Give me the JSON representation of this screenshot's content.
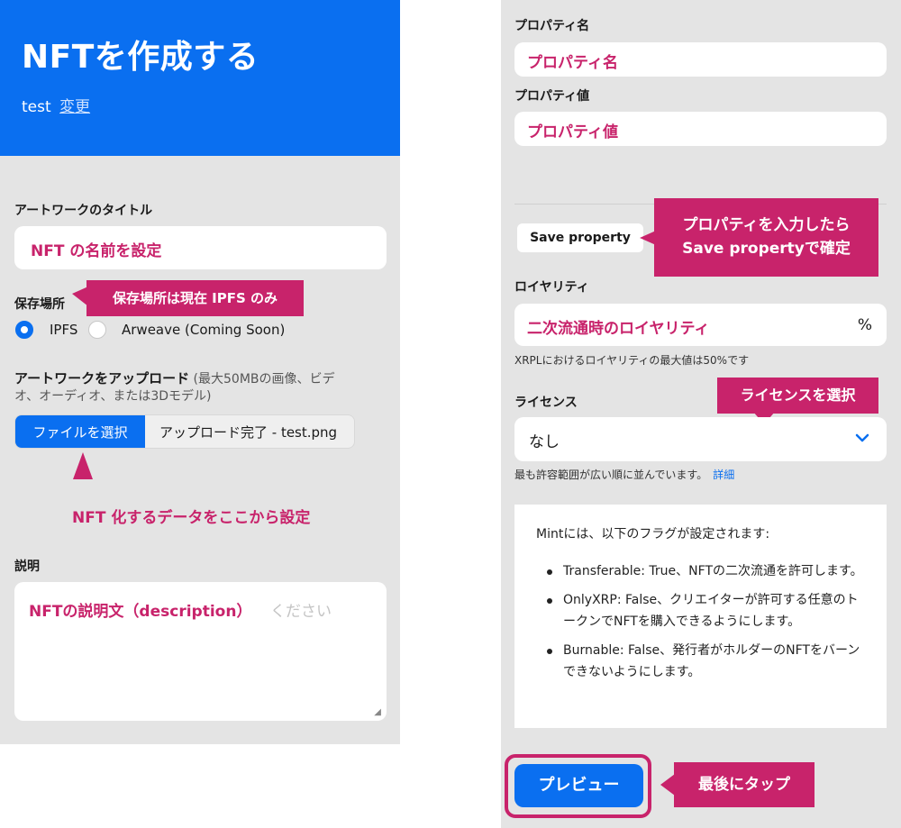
{
  "header": {
    "title": "NFTを作成する",
    "account": "test",
    "change_link": "変更"
  },
  "artwork_title": {
    "label": "アートワークのタイトル",
    "annotation": "NFT の名前を設定"
  },
  "storage": {
    "label": "保存場所",
    "callout": "保存場所は現在 IPFS のみ",
    "options": [
      {
        "label": "IPFS",
        "selected": true
      },
      {
        "label": "Arweave (Coming Soon)",
        "selected": false
      }
    ]
  },
  "upload": {
    "label": "アートワークをアップロード",
    "note": " (最大50MBの画像、ビデオ、オーディオ、または3Dモデル)",
    "button": "ファイルを選択",
    "status": "アップロード完了 - test.png",
    "callout": "NFT 化するデータをここから設定"
  },
  "description": {
    "label": "説明",
    "annotation": "NFTの説明文（description）",
    "placeholder_tail": "ください"
  },
  "property": {
    "name_label": "プロパティ名",
    "name_annotation": "プロパティ名",
    "value_label": "プロパティ値",
    "value_annotation": "プロパティ値",
    "save_button": "Save property",
    "callout_line1": "プロパティを入力したら",
    "callout_line2": "Save propertyで確定"
  },
  "royalty": {
    "label": "ロイヤリティ",
    "annotation": "二次流通時のロイヤリティ",
    "unit": "%",
    "hint": "XRPLにおけるロイヤリティの最大値は50%です"
  },
  "license": {
    "label": "ライセンス",
    "callout": "ライセンスを選択",
    "selected": "なし",
    "hint": "最も許容範囲が広い順に並んでいます。",
    "hint_link": "詳細"
  },
  "flags": {
    "intro": "Mintには、以下のフラグが設定されます:",
    "items": [
      "Transferable: True、NFTの二次流通を許可します。",
      "OnlyXRP: False、クリエイターが許可する任意のトークンでNFTを購入できるようにします。",
      "Burnable: False、発行者がホルダーのNFTをバーンできないようにします。"
    ]
  },
  "preview": {
    "button": "プレビュー",
    "callout": "最後にタップ"
  },
  "colors": {
    "brand_blue": "#0a6ff0",
    "annotation_pink": "#c8236b",
    "panel_gray": "#e4e4e4"
  }
}
